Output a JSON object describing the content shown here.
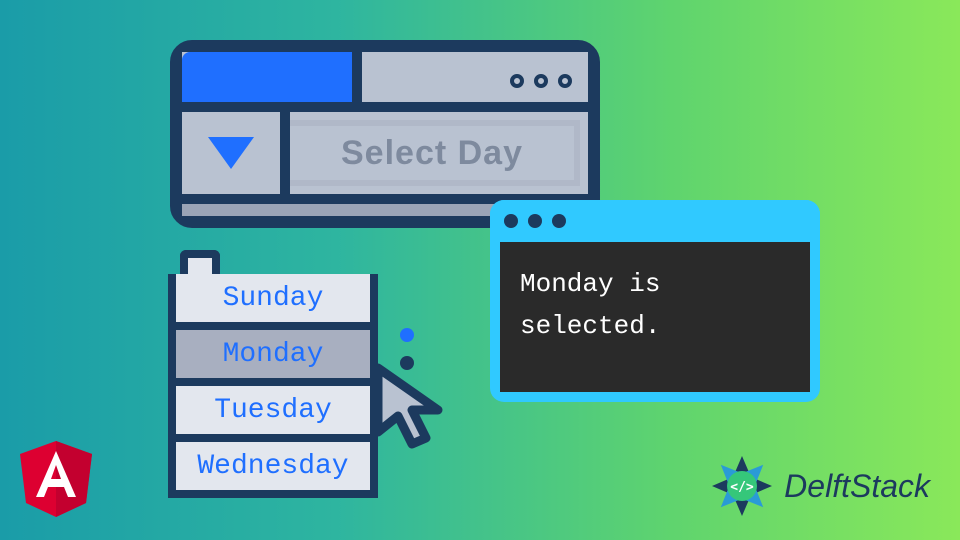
{
  "select": {
    "placeholder": "Select Day",
    "options": [
      "Sunday",
      "Monday",
      "Tuesday",
      "Wednesday"
    ],
    "selected_index": 1
  },
  "terminal": {
    "output": "Monday is selected."
  },
  "brands": {
    "angular": "Angular",
    "delftstack": "DelftStack"
  },
  "colors": {
    "border": "#1c3a5e",
    "accent": "#1f6fff",
    "terminal_frame": "#30c9ff",
    "angular_red": "#dd0031"
  }
}
